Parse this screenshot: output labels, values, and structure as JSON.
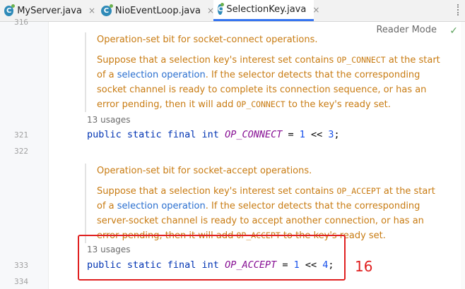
{
  "tabs": [
    {
      "label": "MyServer.java",
      "icon": "C",
      "active": false
    },
    {
      "label": "NioEventLoop.java",
      "icon": "C",
      "active": false
    },
    {
      "label": "SelectionKey.java",
      "icon": "C",
      "active": true
    }
  ],
  "tab_close_glyph": "×",
  "reader_mode_label": "Reader Mode",
  "line_numbers": {
    "top": "316",
    "l321": "321",
    "l322": "322",
    "l333": "333",
    "l334": "334"
  },
  "doc_connect": {
    "summary": "Operation-set bit for socket-connect operations.",
    "p1": "Suppose that a selection key's interest set contains ",
    "code1": "OP_CONNECT",
    "p2": " at the start of a ",
    "link": "selection operation",
    "p3": ". If the selector detects that the corresponding socket channel is ready to complete its connection sequence, or has an error pending, then it will add ",
    "code2": "OP_CONNECT",
    "p4": " to the key's ready set."
  },
  "doc_accept": {
    "summary": "Operation-set bit for socket-accept operations.",
    "p1": "Suppose that a selection key's interest set contains ",
    "code1": "OP_ACCEPT",
    "p2": " at the start of a ",
    "link": "selection operation",
    "p3": ". If the selector detects that the corresponding server-socket channel is ready to accept another connection, or has an error pending, then it will add ",
    "code2": "OP_ACCEPT",
    "p4": " to the key's ready set."
  },
  "usages_connect": "13 usages",
  "usages_accept": "13 usages",
  "code_connect": {
    "modifiers": "public static final int ",
    "name": "OP_CONNECT",
    "eq": " = ",
    "one": "1",
    "shift": " << ",
    "val": "3",
    "semi": ";"
  },
  "code_accept": {
    "modifiers": "public static final int ",
    "name": "OP_ACCEPT",
    "eq": " = ",
    "one": "1",
    "shift": " << ",
    "val": "4",
    "semi": ";"
  },
  "annotation": "16",
  "colors": {
    "accent": "#3574f0",
    "doc_text": "#c87b12",
    "keyword": "#0033b3",
    "constant": "#871094",
    "highlight": "#e02020"
  }
}
